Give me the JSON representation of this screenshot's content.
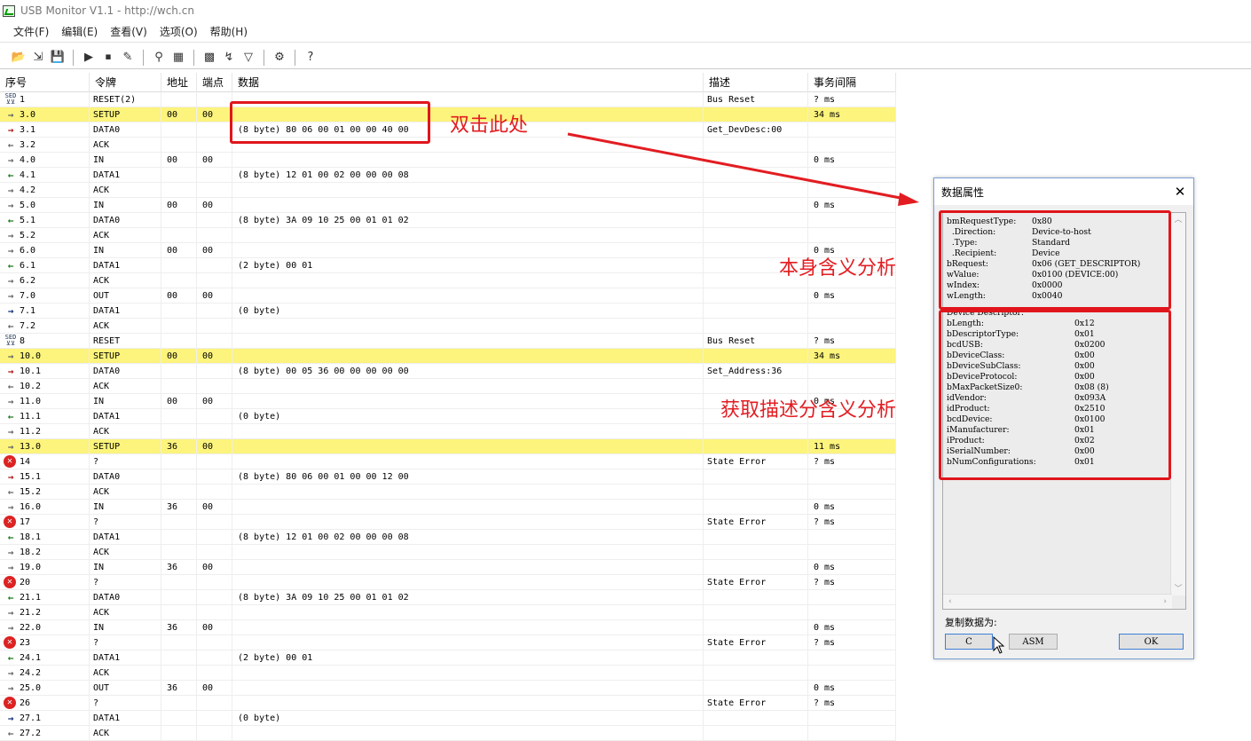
{
  "window": {
    "title": "USB Monitor V1.1 - http://wch.cn"
  },
  "menu": [
    "文件(F)",
    "编辑(E)",
    "查看(V)",
    "选项(O)",
    "帮助(H)"
  ],
  "toolbar": {
    "icons": [
      "open-icon",
      "export-icon",
      "save-icon",
      "play-icon",
      "stop-icon",
      "clear-icon",
      "find-icon",
      "table-icon",
      "color-icon",
      "filter-icon",
      "funnel-icon",
      "settings-icon",
      "help-icon"
    ],
    "glyphs": [
      "📂",
      "⇲",
      "💾",
      "▶",
      "⏹",
      "✎",
      "⚲",
      "▦",
      "▩",
      "↯",
      "▽",
      "⚙",
      "?"
    ]
  },
  "columns": [
    "序号",
    "令牌",
    "地址",
    "端点",
    "数据",
    "描述",
    "事务间隔"
  ],
  "rows": [
    {
      "dir": "sed",
      "seq": "1",
      "token": "RESET(2)",
      "addr": "",
      "ep": "",
      "data": "",
      "desc": "Bus Reset",
      "interval": "? ms",
      "hl": false
    },
    {
      "dir": "out",
      "seq": "3.0",
      "token": "SETUP",
      "addr": "00",
      "ep": "00",
      "data": "",
      "desc": "",
      "interval": "34 ms",
      "hl": true
    },
    {
      "dir": "host",
      "seq": "3.1",
      "token": "DATA0",
      "addr": "",
      "ep": "",
      "data": "(8 byte) 80 06 00 01 00 00 40 00",
      "desc": "Get_DevDesc:00",
      "interval": "",
      "hl": false
    },
    {
      "dir": "back",
      "seq": "3.2",
      "token": "ACK",
      "addr": "",
      "ep": "",
      "data": "",
      "desc": "",
      "interval": "",
      "hl": false
    },
    {
      "dir": "out",
      "seq": "4.0",
      "token": "IN",
      "addr": "00",
      "ep": "00",
      "data": "",
      "desc": "",
      "interval": "0 ms",
      "hl": false
    },
    {
      "dir": "dev",
      "seq": "4.1",
      "token": "DATA1",
      "addr": "",
      "ep": "",
      "data": "(8 byte) 12 01 00 02 00 00 00 08",
      "desc": "",
      "interval": "",
      "hl": false
    },
    {
      "dir": "out",
      "seq": "4.2",
      "token": "ACK",
      "addr": "",
      "ep": "",
      "data": "",
      "desc": "",
      "interval": "",
      "hl": false
    },
    {
      "dir": "out",
      "seq": "5.0",
      "token": "IN",
      "addr": "00",
      "ep": "00",
      "data": "",
      "desc": "",
      "interval": "0 ms",
      "hl": false
    },
    {
      "dir": "dev",
      "seq": "5.1",
      "token": "DATA0",
      "addr": "",
      "ep": "",
      "data": "(8 byte) 3A 09 10 25 00 01 01 02",
      "desc": "",
      "interval": "",
      "hl": false
    },
    {
      "dir": "out",
      "seq": "5.2",
      "token": "ACK",
      "addr": "",
      "ep": "",
      "data": "",
      "desc": "",
      "interval": "",
      "hl": false
    },
    {
      "dir": "out",
      "seq": "6.0",
      "token": "IN",
      "addr": "00",
      "ep": "00",
      "data": "",
      "desc": "",
      "interval": "0 ms",
      "hl": false
    },
    {
      "dir": "dev",
      "seq": "6.1",
      "token": "DATA1",
      "addr": "",
      "ep": "",
      "data": "(2 byte) 00 01",
      "desc": "",
      "interval": "",
      "hl": false
    },
    {
      "dir": "out",
      "seq": "6.2",
      "token": "ACK",
      "addr": "",
      "ep": "",
      "data": "",
      "desc": "",
      "interval": "",
      "hl": false
    },
    {
      "dir": "out",
      "seq": "7.0",
      "token": "OUT",
      "addr": "00",
      "ep": "00",
      "data": "",
      "desc": "",
      "interval": "0 ms",
      "hl": false
    },
    {
      "dir": "blue",
      "seq": "7.1",
      "token": "DATA1",
      "addr": "",
      "ep": "",
      "data": "(0 byte)",
      "desc": "",
      "interval": "",
      "hl": false
    },
    {
      "dir": "back",
      "seq": "7.2",
      "token": "ACK",
      "addr": "",
      "ep": "",
      "data": "",
      "desc": "",
      "interval": "",
      "hl": false
    },
    {
      "dir": "sed",
      "seq": "8",
      "token": "RESET",
      "addr": "",
      "ep": "",
      "data": "",
      "desc": "Bus Reset",
      "interval": "? ms",
      "hl": false
    },
    {
      "dir": "out",
      "seq": "10.0",
      "token": "SETUP",
      "addr": "00",
      "ep": "00",
      "data": "",
      "desc": "",
      "interval": "34 ms",
      "hl": true
    },
    {
      "dir": "host",
      "seq": "10.1",
      "token": "DATA0",
      "addr": "",
      "ep": "",
      "data": "(8 byte) 00 05 36 00 00 00 00 00",
      "desc": "Set_Address:36",
      "interval": "",
      "hl": false
    },
    {
      "dir": "back",
      "seq": "10.2",
      "token": "ACK",
      "addr": "",
      "ep": "",
      "data": "",
      "desc": "",
      "interval": "",
      "hl": false
    },
    {
      "dir": "out",
      "seq": "11.0",
      "token": "IN",
      "addr": "00",
      "ep": "00",
      "data": "",
      "desc": "",
      "interval": "0 ms",
      "hl": false
    },
    {
      "dir": "dev",
      "seq": "11.1",
      "token": "DATA1",
      "addr": "",
      "ep": "",
      "data": "(0 byte)",
      "desc": "",
      "interval": "",
      "hl": false
    },
    {
      "dir": "out",
      "seq": "11.2",
      "token": "ACK",
      "addr": "",
      "ep": "",
      "data": "",
      "desc": "",
      "interval": "",
      "hl": false
    },
    {
      "dir": "out",
      "seq": "13.0",
      "token": "SETUP",
      "addr": "36",
      "ep": "00",
      "data": "",
      "desc": "",
      "interval": "11 ms",
      "hl": true
    },
    {
      "dir": "err",
      "seq": "14",
      "token": "?",
      "addr": "",
      "ep": "",
      "data": "",
      "desc": "State Error",
      "interval": "? ms",
      "hl": false
    },
    {
      "dir": "host",
      "seq": "15.1",
      "token": "DATA0",
      "addr": "",
      "ep": "",
      "data": "(8 byte) 80 06 00 01 00 00 12 00",
      "desc": "",
      "interval": "",
      "hl": false
    },
    {
      "dir": "back",
      "seq": "15.2",
      "token": "ACK",
      "addr": "",
      "ep": "",
      "data": "",
      "desc": "",
      "interval": "",
      "hl": false
    },
    {
      "dir": "out",
      "seq": "16.0",
      "token": "IN",
      "addr": "36",
      "ep": "00",
      "data": "",
      "desc": "",
      "interval": "0 ms",
      "hl": false
    },
    {
      "dir": "err",
      "seq": "17",
      "token": "?",
      "addr": "",
      "ep": "",
      "data": "",
      "desc": "State Error",
      "interval": "? ms",
      "hl": false
    },
    {
      "dir": "dev",
      "seq": "18.1",
      "token": "DATA1",
      "addr": "",
      "ep": "",
      "data": "(8 byte) 12 01 00 02 00 00 00 08",
      "desc": "",
      "interval": "",
      "hl": false
    },
    {
      "dir": "out",
      "seq": "18.2",
      "token": "ACK",
      "addr": "",
      "ep": "",
      "data": "",
      "desc": "",
      "interval": "",
      "hl": false
    },
    {
      "dir": "out",
      "seq": "19.0",
      "token": "IN",
      "addr": "36",
      "ep": "00",
      "data": "",
      "desc": "",
      "interval": "0 ms",
      "hl": false
    },
    {
      "dir": "err",
      "seq": "20",
      "token": "?",
      "addr": "",
      "ep": "",
      "data": "",
      "desc": "State Error",
      "interval": "? ms",
      "hl": false
    },
    {
      "dir": "dev",
      "seq": "21.1",
      "token": "DATA0",
      "addr": "",
      "ep": "",
      "data": "(8 byte) 3A 09 10 25 00 01 01 02",
      "desc": "",
      "interval": "",
      "hl": false
    },
    {
      "dir": "out",
      "seq": "21.2",
      "token": "ACK",
      "addr": "",
      "ep": "",
      "data": "",
      "desc": "",
      "interval": "",
      "hl": false
    },
    {
      "dir": "out",
      "seq": "22.0",
      "token": "IN",
      "addr": "36",
      "ep": "00",
      "data": "",
      "desc": "",
      "interval": "0 ms",
      "hl": false
    },
    {
      "dir": "err",
      "seq": "23",
      "token": "?",
      "addr": "",
      "ep": "",
      "data": "",
      "desc": "State Error",
      "interval": "? ms",
      "hl": false
    },
    {
      "dir": "dev",
      "seq": "24.1",
      "token": "DATA1",
      "addr": "",
      "ep": "",
      "data": "(2 byte) 00 01",
      "desc": "",
      "interval": "",
      "hl": false
    },
    {
      "dir": "out",
      "seq": "24.2",
      "token": "ACK",
      "addr": "",
      "ep": "",
      "data": "",
      "desc": "",
      "interval": "",
      "hl": false
    },
    {
      "dir": "out",
      "seq": "25.0",
      "token": "OUT",
      "addr": "36",
      "ep": "00",
      "data": "",
      "desc": "",
      "interval": "0 ms",
      "hl": false
    },
    {
      "dir": "err",
      "seq": "26",
      "token": "?",
      "addr": "",
      "ep": "",
      "data": "",
      "desc": "State Error",
      "interval": "? ms",
      "hl": false
    },
    {
      "dir": "blue",
      "seq": "27.1",
      "token": "DATA1",
      "addr": "",
      "ep": "",
      "data": "(0 byte)",
      "desc": "",
      "interval": "",
      "hl": false
    },
    {
      "dir": "back",
      "seq": "27.2",
      "token": "ACK",
      "addr": "",
      "ep": "",
      "data": "",
      "desc": "",
      "interval": "",
      "hl": false
    }
  ],
  "dir_glyphs": {
    "out": "→",
    "host": "→",
    "back": "←",
    "dev": "←",
    "blue": "→",
    "err": "✕",
    "sed": "SED\n⊻⊻"
  },
  "dir_colors": {
    "out": "#666666",
    "host": "#b01818",
    "back": "#666666",
    "dev": "#1f7a1f",
    "blue": "#14307a",
    "err": "#ffffff",
    "sed": "#223355"
  },
  "highlight_color": "#fcf47c",
  "dialog": {
    "title": "数据属性",
    "close": "✕",
    "setup_lines": [
      [
        "bmRequestType:",
        "0x80"
      ],
      [
        "  .Direction:",
        "Device-to-host"
      ],
      [
        "  .Type:",
        "Standard"
      ],
      [
        "  .Recipient:",
        "Device"
      ],
      [
        "bRequest:",
        "0x06 (GET_DESCRIPTOR)"
      ],
      [
        "wValue:",
        "0x0100 (DEVICE:00)"
      ],
      [
        "wIndex:",
        "0x0000"
      ],
      [
        "wLength:",
        "0x0040"
      ]
    ],
    "desc_title": "Device Descriptor:",
    "desc_lines": [
      [
        "bLength:",
        "0x12"
      ],
      [
        "bDescriptorType:",
        "0x01"
      ],
      [
        "bcdUSB:",
        "0x0200"
      ],
      [
        "bDeviceClass:",
        "0x00"
      ],
      [
        "bDeviceSubClass:",
        "0x00"
      ],
      [
        "bDeviceProtocol:",
        "0x00"
      ],
      [
        "bMaxPacketSize0:",
        "0x08 (8)"
      ],
      [
        "idVendor:",
        "0x093A"
      ],
      [
        "idProduct:",
        "0x2510"
      ],
      [
        "bcdDevice:",
        "0x0100"
      ],
      [
        "iManufacturer:",
        "0x01"
      ],
      [
        "iProduct:",
        "0x02"
      ],
      [
        "iSerialNumber:",
        "0x00"
      ],
      [
        "bNumConfigurations:",
        "0x01"
      ]
    ],
    "copy_label": "复制数据为:",
    "btn_c": "C",
    "btn_asm": "ASM",
    "btn_ok": "OK"
  },
  "annotations": {
    "dbl_click": "双击此处",
    "self_meaning": "本身含义分析",
    "desc_meaning": "获取描述分含义分析",
    "color": "#e21d22"
  }
}
